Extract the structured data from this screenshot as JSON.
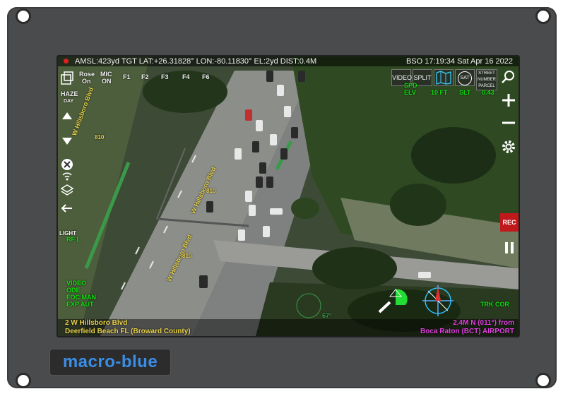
{
  "status": {
    "top_left": "AMSL:423yd TGT LAT:+26.31828° LON:-80.11830° EL:2yd DIST:0.4M",
    "top_right": "BSO 17:19:34 Sat Apr 16 2022"
  },
  "left_panel": {
    "rose": "Rose",
    "on": "On",
    "mic": "MIC",
    "mic_state": "ON",
    "haze": "HAZE",
    "day": "DAY",
    "light": "LIGHT",
    "rf": "RF L",
    "video": "VIDEO",
    "ode": "ODE",
    "foc": "FOC MAN",
    "exp": "EXP AUT"
  },
  "fkeys": [
    "F1",
    "F2",
    "F3",
    "F4",
    "F6"
  ],
  "top_right_buttons": {
    "video": "VIDEO",
    "split": "SPLIT",
    "sat": "SAT",
    "street": "STREET",
    "number": "NUMBER",
    "parcel": "PARCEL"
  },
  "readouts": {
    "spd": "SPD",
    "elv": "ELV",
    "elv_val": "10 FT",
    "slt": "SLT",
    "dist": "0.43"
  },
  "right_panel": {
    "rec": "REC"
  },
  "bottom": {
    "address_line1": "2 W Hillsboro Blvd",
    "address_line2": "Deerfield Beach FL (Broward County)",
    "dist_line1": "2.4M N (011°) from",
    "dist_line2": "Boca Raton (BCT) AIRPORT",
    "trk": "TRK COR",
    "heading": "67°"
  },
  "street_labels": {
    "a": "W Hillsboro Blvd",
    "b": "W Hillsboro Blvd",
    "c": "W Hillsboro Blvd",
    "d": "W Hillsboro Blvd",
    "n810a": "810",
    "n810b": "810",
    "n810c": "810"
  },
  "logo": "macro-blue"
}
